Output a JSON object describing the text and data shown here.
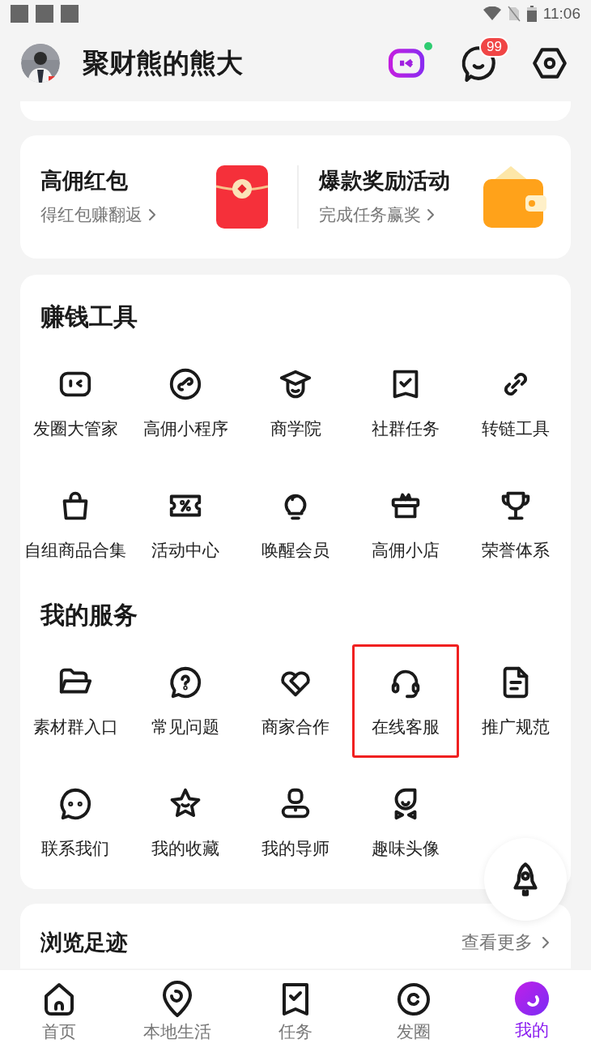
{
  "status_bar": {
    "time": "11:06"
  },
  "profile": {
    "name": "聚财熊的熊大",
    "message_badge": "99"
  },
  "promo_cards": [
    {
      "kind": "red-envelope",
      "title": "高佣红包",
      "subtitle": "得红包赚翻返"
    },
    {
      "kind": "wallet",
      "title": "爆款奖励活动",
      "subtitle": "完成任务赢奖"
    }
  ],
  "sections": [
    {
      "title": "赚钱工具",
      "items": [
        {
          "label": "发圈大管家",
          "highlighted": false
        },
        {
          "label": "高佣小程序",
          "highlighted": false
        },
        {
          "label": "商学院",
          "highlighted": false
        },
        {
          "label": "社群任务",
          "highlighted": false
        },
        {
          "label": "转链工具",
          "highlighted": false
        },
        {
          "label": "自组商品合集",
          "highlighted": false
        },
        {
          "label": "活动中心",
          "highlighted": false
        },
        {
          "label": "唤醒会员",
          "highlighted": false
        },
        {
          "label": "高佣小店",
          "highlighted": false
        },
        {
          "label": "荣誉体系",
          "highlighted": false
        }
      ]
    },
    {
      "title": "我的服务",
      "items": [
        {
          "label": "素材群入口",
          "highlighted": false
        },
        {
          "label": "常见问题",
          "highlighted": false
        },
        {
          "label": "商家合作",
          "highlighted": false
        },
        {
          "label": "在线客服",
          "highlighted": true
        },
        {
          "label": "推广规范",
          "highlighted": false
        },
        {
          "label": "联系我们",
          "highlighted": false
        },
        {
          "label": "我的收藏",
          "highlighted": false
        },
        {
          "label": "我的导师",
          "highlighted": false
        },
        {
          "label": "趣味头像",
          "highlighted": false
        }
      ]
    }
  ],
  "history": {
    "title": "浏览足迹",
    "more": "查看更多"
  },
  "bottom_nav": [
    {
      "label": "首页",
      "selected": false
    },
    {
      "label": "本地生活",
      "selected": false
    },
    {
      "label": "任务",
      "selected": false
    },
    {
      "label": "发圈",
      "selected": false
    },
    {
      "label": "我的",
      "selected": true
    }
  ]
}
